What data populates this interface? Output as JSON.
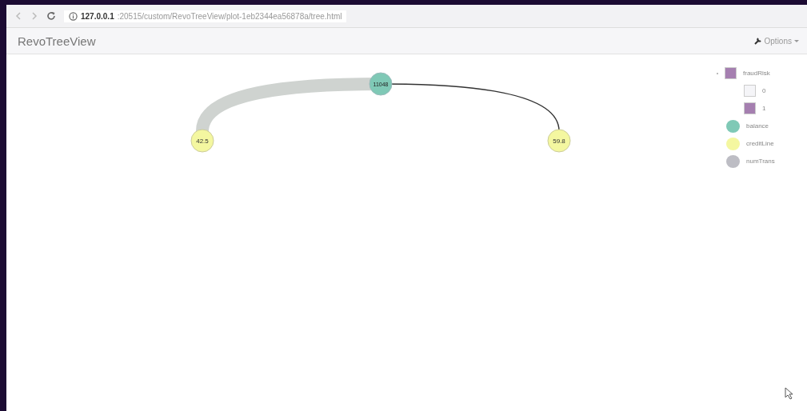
{
  "browser": {
    "url_host": "127.0.0.1",
    "url_rest": ":20515/custom/RevoTreeView/plot-1eb2344ea56878a/tree.html"
  },
  "header": {
    "title": "RevoTreeView",
    "options": "Options"
  },
  "tree": {
    "root": {
      "label": "11048",
      "color": "#7fc9b6"
    },
    "children": [
      {
        "label": "42.5",
        "color": "#f4f7a0",
        "kind": "thick"
      },
      {
        "label": "59.8",
        "color": "#f4f7a0",
        "kind": "thin"
      }
    ]
  },
  "legend": {
    "group": {
      "label": "fraudRisk",
      "color": "#a57fb0"
    },
    "levels": [
      {
        "label": "0",
        "color": "#f5f5f8"
      },
      {
        "label": "1",
        "color": "#a57fb0"
      }
    ],
    "keys": [
      {
        "label": "balance",
        "color": "#7fc9b6"
      },
      {
        "label": "creditLine",
        "color": "#f4f7a0"
      },
      {
        "label": "numTrans",
        "color": "#bdbdc4"
      }
    ]
  }
}
